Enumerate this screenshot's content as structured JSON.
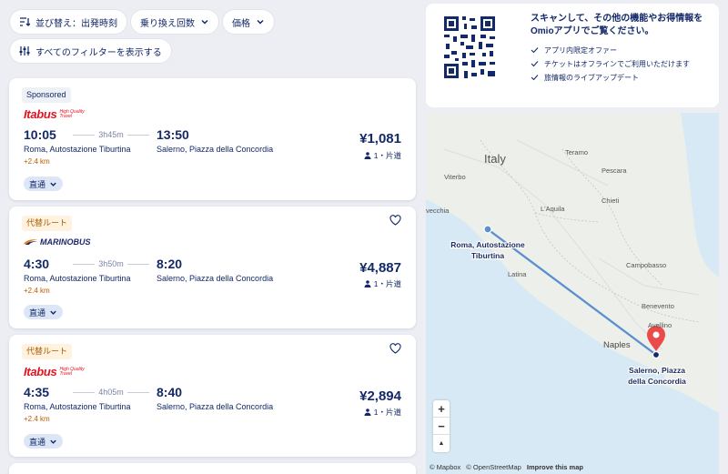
{
  "filters": {
    "sort": "並び替え：出発時刻",
    "transfers": "乗り換え回数",
    "price": "価格",
    "all_filters": "すべてのフィルターを表示する"
  },
  "results": [
    {
      "tag": "Sponsored",
      "operator": "Itabus",
      "operator_tagline": "High Quality Travel",
      "dep_time": "10:05",
      "duration": "3h45m",
      "arr_time": "13:50",
      "from": "Roma, Autostazione Tiburtina",
      "to": "Salerno, Piazza della Concordia",
      "walk": "+2.4 km",
      "direct_label": "直通",
      "price": "¥1,081",
      "passengers": "1・片道"
    },
    {
      "tag": "代替ルート",
      "operator": "MARINOBUS",
      "dep_time": "4:30",
      "duration": "3h50m",
      "arr_time": "8:20",
      "from": "Roma, Autostazione Tiburtina",
      "to": "Salerno, Piazza della Concordia",
      "walk": "+2.4 km",
      "direct_label": "直通",
      "price": "¥4,887",
      "passengers": "1・片道"
    },
    {
      "tag": "代替ルート",
      "operator": "Itabus",
      "operator_tagline": "High Quality Travel",
      "dep_time": "4:35",
      "duration": "4h05m",
      "arr_time": "8:40",
      "from": "Roma, Autostazione Tiburtina",
      "to": "Salerno, Piazza della Concordia",
      "walk": "+2.4 km",
      "direct_label": "直通",
      "price": "¥2,894",
      "passengers": "1・片道"
    }
  ],
  "promo": {
    "title": "スキャンして、その他の機能やお得情報をOmioアプリでご覧ください。",
    "features": [
      "アプリ内限定オファー",
      "チケットはオフラインでご利用いただけます",
      "旅情報のライブアップデート"
    ]
  },
  "map": {
    "country": "Italy",
    "origin_label_1": "Roma, Autostazione",
    "origin_label_2": "Tiburtina",
    "dest_label_1": "Salerno, Piazza",
    "dest_label_2": "della Concordia",
    "places": {
      "teramo": "Teramo",
      "pescara": "Pescara",
      "viterbo": "Viterbo",
      "laquila": "L'Aquila",
      "chieti": "Chieti",
      "civitavecchia": "vecchia",
      "latina": "Latina",
      "campobasso": "Campobasso",
      "benevento": "Benevento",
      "avellino": "Avellino",
      "naples": "Naples"
    },
    "zoom_in": "+",
    "zoom_out": "−",
    "compass": "▲",
    "attribution_mapbox": "© Mapbox",
    "attribution_osm": "© OpenStreetMap",
    "improve": "Improve this map"
  },
  "colors": {
    "brand_navy": "#132968",
    "itabus_red": "#e5121e",
    "route_blue": "#5b8fd0",
    "pin_red": "#ea4a4a"
  }
}
